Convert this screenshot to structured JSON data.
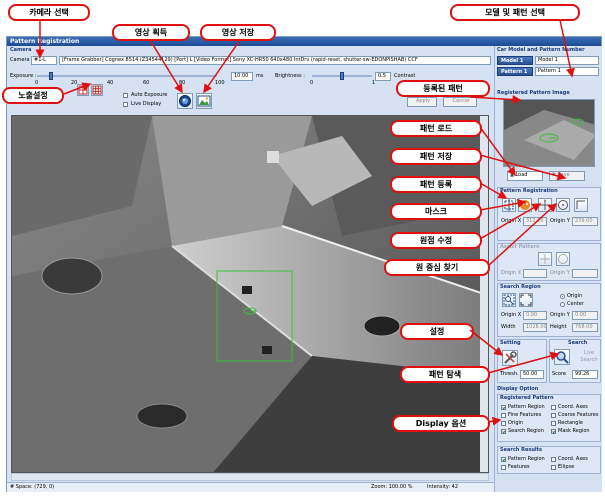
{
  "window": {
    "title": "Pattern Registration"
  },
  "camera": {
    "section": "Camera",
    "camera_label": "Camera",
    "camera_value": "#1-L",
    "info": "[Frame Grabber] Cognex 8514 (Z34544129) [Port] L [Video Format] Sony XC-HR50 640x480 IntDrv (rapid-reset, shutter-sw-EDONPISHAB) CCF",
    "exposure_label": "Exposure :",
    "exposure_ticks": [
      "0",
      "20",
      "40",
      "60",
      "80",
      "100"
    ],
    "exposure_value": "10.00",
    "exposure_unit": "ms",
    "exposure_level": 0.07,
    "brightness_label": "Brightness :",
    "brightness_ticks": [
      "0",
      "1"
    ],
    "brightness_value": "0.5",
    "brightness_level": 0.5,
    "contrast_label": "Contrast",
    "auto_exposure": "Auto Exposure",
    "live_display": "Live Display",
    "auto_exposure_checked": false,
    "live_display_checked": false,
    "apply": "Apply",
    "cancel": "Cancel"
  },
  "right": {
    "car_model_header": "Car Model and Pattern Number",
    "model_label": "Model 1",
    "model_value": "Model 1",
    "pattern_label": "Pattern 1",
    "pattern_value": "Pattern 1",
    "registered_image_header": "Registered Pattern Image",
    "load": "Load",
    "save": "Save",
    "pattern_registration": "Pattern Registration",
    "origin_x_label": "Origin X",
    "origin_x": "312.00",
    "origin_y_label": "Origin Y",
    "origin_y": "239.00",
    "assist_pattern": "Assist Pattern",
    "assist_origin_x_label": "Origin X",
    "assist_origin_y_label": "Origin Y",
    "search_region": "Search Region",
    "origin": "Origin",
    "center": "Center",
    "sr_origin_x_label": "Origin X",
    "sr_origin_x": "0.00",
    "sr_origin_y_label": "Origin Y",
    "sr_origin_y": "0.00",
    "width_label": "Width",
    "width": "1028.00",
    "height_label": "Height",
    "height": "768.00",
    "setting": "Setting",
    "search": "Search",
    "live_search": "Live Search",
    "thresh_label": "Thresh.",
    "thresh": "50.00",
    "score_label": "Score",
    "score": "99.26",
    "display_option": "Display Option",
    "registered_pattern": "Registered Pattern",
    "reg_opts": [
      {
        "label": "Pattern Region",
        "checked": true
      },
      {
        "label": "Coord. Axes",
        "checked": false
      },
      {
        "label": "Fine Features",
        "checked": false
      },
      {
        "label": "Coarse Features",
        "checked": false
      },
      {
        "label": "Origin",
        "checked": false
      },
      {
        "label": "Rectangle",
        "checked": false
      },
      {
        "label": "Search Region",
        "checked": true
      },
      {
        "label": "Mask Region",
        "checked": true
      }
    ],
    "search_results": "Search Results",
    "res_opts": [
      {
        "label": "Pattern Region",
        "checked": true
      },
      {
        "label": "Coord. Axes",
        "checked": false
      },
      {
        "label": "Features",
        "checked": false
      },
      {
        "label": "Ellipse",
        "checked": false
      }
    ]
  },
  "status": {
    "space": "# Space: (729, 0)",
    "zoom": "Zoom: 100.00 %",
    "intensity": "Intensity: 42"
  },
  "callouts": {
    "camera_select": "카메라 선택",
    "capture": "영상 획득",
    "save_image": "영상 저장",
    "model_select": "모델 및 패턴 선택",
    "exposure": "노출설정",
    "registered": "등록된 패턴",
    "pattern_load": "패턴 로드",
    "pattern_save": "패턴 저장",
    "pattern_register": "패턴 등록",
    "mask": "마스크",
    "origin_edit": "원점 수정",
    "center_find": "원 중심 찾기",
    "setting": "설정",
    "pattern_search": "패턴 탐색",
    "display_option": "Display 옵션"
  },
  "colors": {
    "accent": "#2a5296",
    "callout_border": "#e01010",
    "pattern_box": "#3ac03a"
  }
}
